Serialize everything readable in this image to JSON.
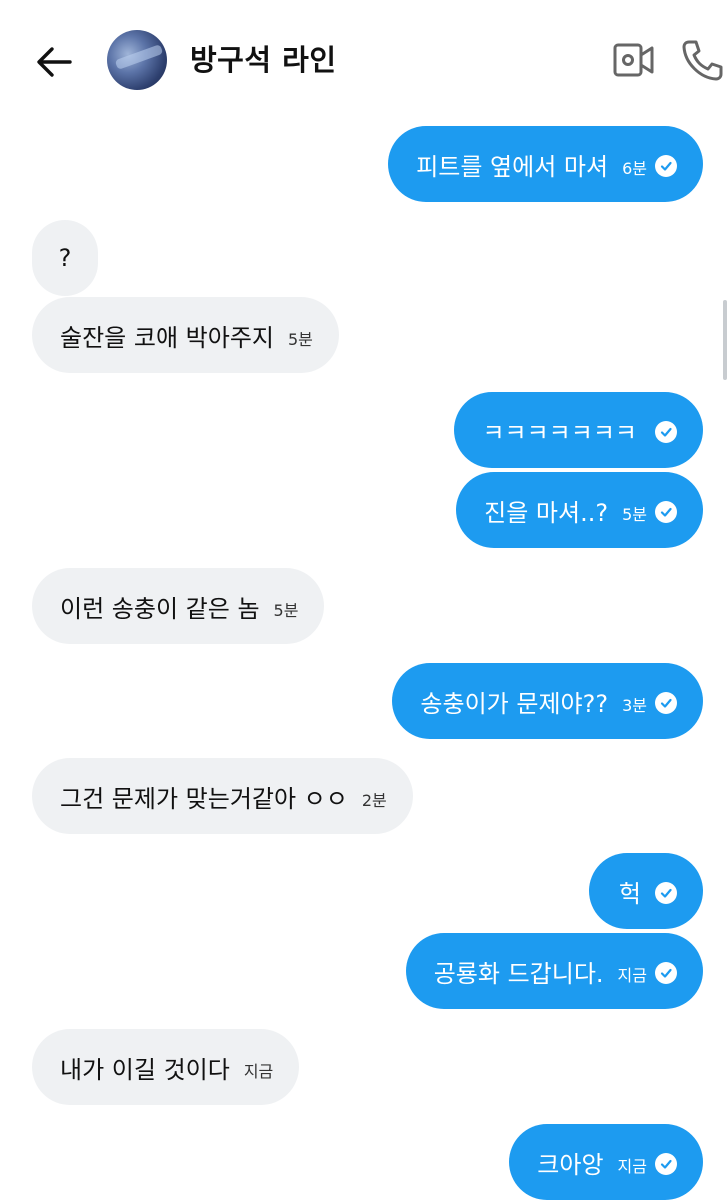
{
  "header": {
    "title": "방구석 라인",
    "back_icon": "arrow-left-icon",
    "video_icon": "video-camera-icon",
    "call_icon": "phone-icon"
  },
  "colors": {
    "outgoing_bubble": "#1d9bf0",
    "incoming_bubble": "#eff1f3"
  },
  "messages": [
    {
      "direction": "out",
      "text": "피트를 옆에서 마셔",
      "time": "6분",
      "read": true
    },
    {
      "direction": "in",
      "text": "?",
      "time": ""
    },
    {
      "direction": "in",
      "text": "술잔을 코애 박아주지",
      "time": "5분"
    },
    {
      "direction": "out",
      "text": "ㅋㅋㅋㅋㅋㅋㅋ",
      "time": "",
      "read": true
    },
    {
      "direction": "out",
      "text": "진을 마셔..?",
      "time": "5분",
      "read": true
    },
    {
      "direction": "in",
      "text": "이런 송충이 같은 놈",
      "time": "5분"
    },
    {
      "direction": "out",
      "text": "송충이가 문제야??",
      "time": "3분",
      "read": true
    },
    {
      "direction": "in",
      "text": "그건 문제가 맞는거같아 ㅇㅇ",
      "time": "2분"
    },
    {
      "direction": "out",
      "text": "헉",
      "time": "",
      "read": true
    },
    {
      "direction": "out",
      "text": "공룡화 드갑니다.",
      "time": "지금",
      "read": true
    },
    {
      "direction": "in",
      "text": "내가 이길 것이다",
      "time": "지금"
    },
    {
      "direction": "out",
      "text": "크아앙",
      "time": "지금",
      "read": true
    }
  ]
}
